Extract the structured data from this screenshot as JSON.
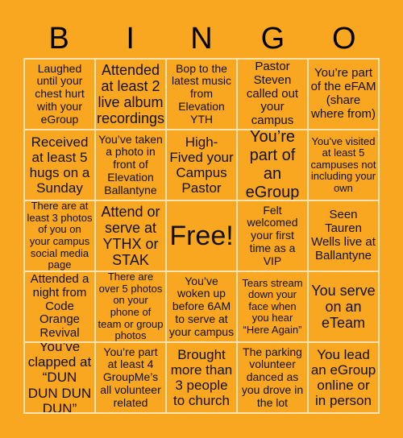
{
  "title_letters": [
    "B",
    "I",
    "N",
    "G",
    "O"
  ],
  "colors": {
    "background": "#F9A621",
    "grid_line": "#FDE3B0",
    "text": "#111111"
  },
  "cells": [
    [
      "Laughed until your chest hurt with your eGroup",
      "Attended at least 2 live album recordings",
      "Bop to the latest music from Elevation YTH",
      "Pastor Steven called out your campus",
      "You’re part of the eFAM (share where from)"
    ],
    [
      "Received at least 5 hugs on a Sunday",
      "You’ve taken a photo in front of Elevation Ballantyne",
      "High-Fived your Campus Pastor",
      "You’re part of an eGroup",
      "You’ve visited at least 5 campuses not including your own"
    ],
    [
      "There are at least 3 photos of you on your campus social media page",
      "Attend or serve at YTHX or STAK",
      "Free!",
      "Felt welcomed your first time as a VIP",
      "Seen Tauren Wells live at Ballantyne"
    ],
    [
      "Attended a night from Code Orange Revival",
      "There are over 5 photos on your phone of team or group photos",
      "You’ve woken up before 6AM to serve at your campus",
      "Tears stream down your face when you hear “Here Again”",
      "You serve on an eTeam"
    ],
    [
      "You’ve clapped at “DUN DUN DUN DUN”",
      "You’re part at least 4 GroupMe’s all volunteer related",
      "Brought more than 3 people to church",
      "The parking volunteer danced as you drove in the lot",
      "You lead an eGroup online or in person"
    ]
  ]
}
